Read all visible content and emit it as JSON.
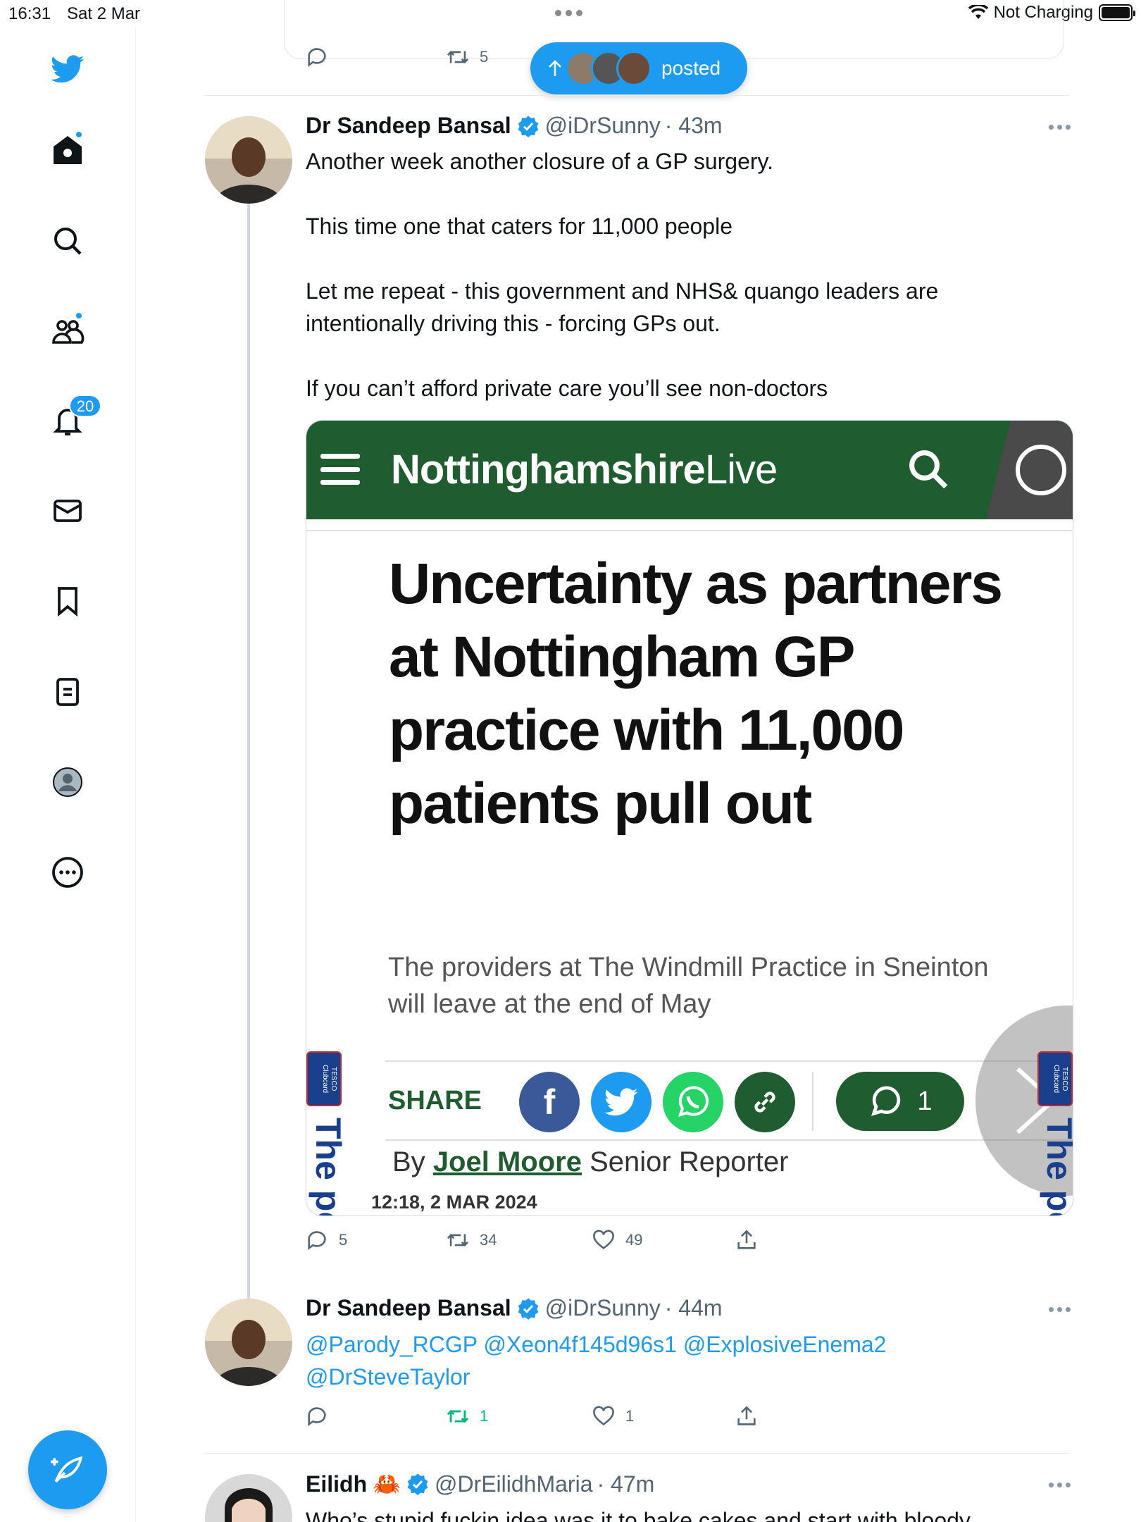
{
  "status_bar": {
    "time": "16:31",
    "date": "Sat 2 Mar",
    "charging": "Not Charging"
  },
  "sidebar": {
    "items": [
      {
        "name": "home",
        "icon": "home-icon",
        "has_dot": true
      },
      {
        "name": "explore",
        "icon": "search-icon"
      },
      {
        "name": "communities",
        "icon": "communities-icon",
        "has_dot": true
      },
      {
        "name": "notifications",
        "icon": "bell-icon",
        "badge": "20"
      },
      {
        "name": "messages",
        "icon": "mail-icon"
      },
      {
        "name": "bookmarks",
        "icon": "bookmark-icon"
      },
      {
        "name": "lists",
        "icon": "list-icon"
      },
      {
        "name": "profile",
        "icon": "profile-avatar-icon"
      },
      {
        "name": "more",
        "icon": "more-circle-icon"
      }
    ],
    "accent": "#1d9bf0"
  },
  "top_actions": {
    "retweets": "5"
  },
  "posted_pill": {
    "label": "posted"
  },
  "tweets": [
    {
      "name": "Dr Sandeep Bansal",
      "handle": "@iDrSunny",
      "time": "· 43m",
      "text": [
        "Another week another closure of a GP surgery.",
        "",
        "This time one that caters for 11,000 people",
        "",
        "Let me repeat - this government and NHS& quango leaders are intentionally driving this - forcing GPs out.",
        "",
        "If you can’t afford private care you’ll see non-doctors"
      ],
      "replies": "5",
      "retweets": "34",
      "likes": "49"
    },
    {
      "name": "Dr Sandeep Bansal",
      "handle": "@iDrSunny",
      "time": "· 44m",
      "mentions": "@Parody_RCGP @Xeon4f145d96s1 @ExplosiveEnema2 @DrSteveTaylor",
      "replies": "",
      "retweets": "1",
      "likes": "1"
    },
    {
      "name": "Eilidh",
      "emoji": "🦀",
      "handle": "@DrEilidhMaria",
      "time": "· 47m",
      "text_partial": "Who’s stupid fuckin idea was it to bake cakes and start with bloody"
    }
  ],
  "article": {
    "brand_bold": "Nottinghamshire",
    "brand_light": "Live",
    "headline": "Uncertainty as partners at Nottingham GP practice with 11,000 patients pull out",
    "standfirst": "The providers at The Windmill Practice in Sneinton will leave at the end of May",
    "share_label": "SHARE",
    "comment_count": "1",
    "byline_prefix": "By",
    "author": "Joel Moore",
    "role": "Senior Reporter",
    "dateline": "12:18, 2 MAR 2024",
    "ad_box": "TESCO Clubcard",
    "ad_text": "The pc",
    "brand_color": "#1f5c2f"
  }
}
